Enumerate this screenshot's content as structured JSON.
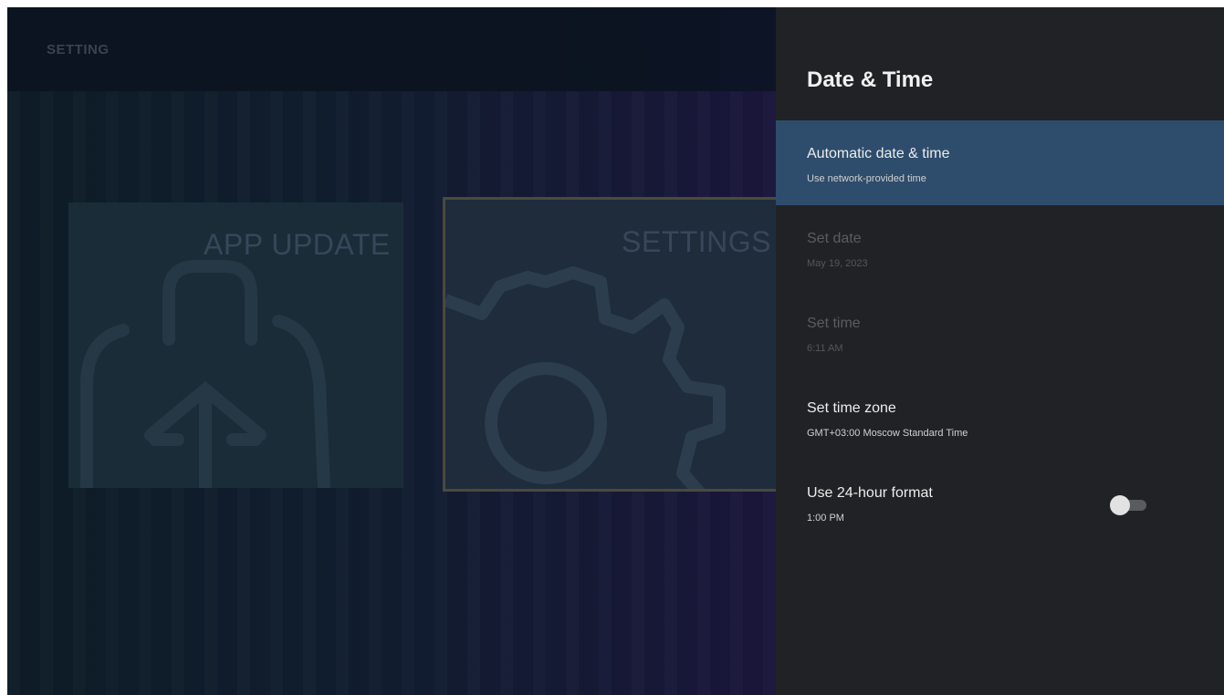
{
  "launcher": {
    "title": "SETTING",
    "tiles": [
      {
        "label": "APP UPDATE",
        "icon": "app-update-icon"
      },
      {
        "label": "SETTINGS",
        "icon": "gear-icon"
      }
    ]
  },
  "panel": {
    "title": "Date & Time",
    "items": [
      {
        "title": "Automatic date & time",
        "subtitle": "Use network-provided time",
        "state": "focused"
      },
      {
        "title": "Set date",
        "subtitle": "May 19, 2023",
        "state": "disabled"
      },
      {
        "title": "Set time",
        "subtitle": "6:11 AM",
        "state": "disabled"
      },
      {
        "title": "Set time zone",
        "subtitle": "GMT+03:00 Moscow Standard Time",
        "state": "enabled"
      },
      {
        "title": "Use 24-hour format",
        "subtitle": "1:00 PM",
        "state": "enabled",
        "toggle_on": false
      }
    ]
  },
  "colors": {
    "panel_bg": "#212225",
    "focus_bg": "#2e4d6c",
    "settings_tile_border": "#4a4a3e"
  }
}
